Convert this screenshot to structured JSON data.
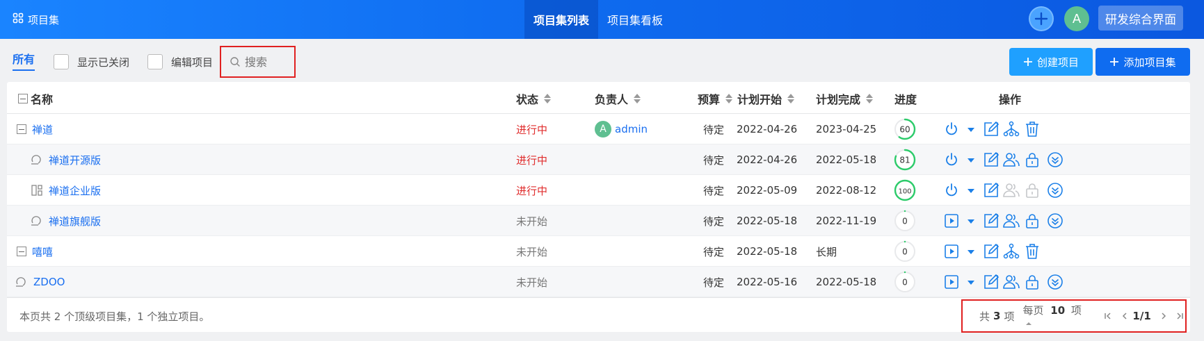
{
  "header": {
    "brand_label": "项目集",
    "tabs": [
      {
        "label": "项目集列表",
        "active": true
      },
      {
        "label": "项目集看板",
        "active": false
      }
    ],
    "avatar_letter": "A",
    "workspace_label": "研发综合界面"
  },
  "toolbar": {
    "all_label": "所有",
    "show_closed_label": "显示已关闭",
    "edit_project_label": "编辑项目",
    "search_placeholder": "搜索",
    "create_project_label": "创建项目",
    "add_program_label": "添加项目集"
  },
  "table": {
    "columns": {
      "name": "名称",
      "status": "状态",
      "owner": "负责人",
      "budget": "预算",
      "plan_start": "计划开始",
      "plan_end": "计划完成",
      "progress": "进度",
      "actions": "操作"
    },
    "rows": [
      {
        "name": "禅道",
        "type": "program",
        "status": "进行中",
        "status_kind": "doing",
        "owner": "admin",
        "budget": "待定",
        "start": "2022-04-26",
        "end": "2023-04-25",
        "progress": 60,
        "start_icon": "power"
      },
      {
        "name": "禅道开源版",
        "type": "project-scrum",
        "status": "进行中",
        "status_kind": "doing",
        "owner": "",
        "budget": "待定",
        "start": "2022-04-26",
        "end": "2022-05-18",
        "progress": 81,
        "start_icon": "power"
      },
      {
        "name": "禅道企业版",
        "type": "project-kanban",
        "status": "进行中",
        "status_kind": "doing",
        "owner": "",
        "budget": "待定",
        "start": "2022-05-09",
        "end": "2022-08-12",
        "progress": 100,
        "start_icon": "power"
      },
      {
        "name": "禅道旗舰版",
        "type": "project-scrum",
        "status": "未开始",
        "status_kind": "wait",
        "owner": "",
        "budget": "待定",
        "start": "2022-05-18",
        "end": "2022-11-19",
        "progress": 0,
        "start_icon": "play"
      },
      {
        "name": "嘻嘻",
        "type": "program",
        "status": "未开始",
        "status_kind": "wait",
        "owner": "",
        "budget": "待定",
        "start": "2022-05-18",
        "end": "长期",
        "progress": 0,
        "start_icon": "play"
      },
      {
        "name": "ZDOO",
        "type": "project-scrum",
        "status": "未开始",
        "status_kind": "wait",
        "owner": "",
        "budget": "待定",
        "start": "2022-05-16",
        "end": "2022-05-18",
        "progress": 0,
        "start_icon": "play"
      }
    ]
  },
  "footer": {
    "summary": "本页共 2 个顶级项目集，1 个独立项目。",
    "total_prefix": "共",
    "total_count": "3",
    "total_suffix": "项",
    "per_page_prefix": "每页",
    "per_page_count": "10",
    "per_page_suffix": "项",
    "page_indicator": "1/1"
  },
  "colors": {
    "header_blue": "#0f6cf0",
    "link_blue": "#1a6ff0",
    "running_red": "#e02d2d",
    "progress_green": "#2ccb6a",
    "icon_blue": "#1a7fe8"
  },
  "icons": {
    "brand": "grid-icon",
    "add": "plus-icon",
    "search": "search-icon",
    "collapse": "minus-square-icon",
    "scrum": "cycle-icon",
    "kanban": "kanban-icon",
    "start": "power-icon",
    "play": "play-icon",
    "edit": "edit-icon",
    "link": "hierarchy-icon",
    "delete": "trash-icon",
    "members": "users-icon",
    "privilege": "lock-icon",
    "more": "chevron-double-down-icon"
  }
}
